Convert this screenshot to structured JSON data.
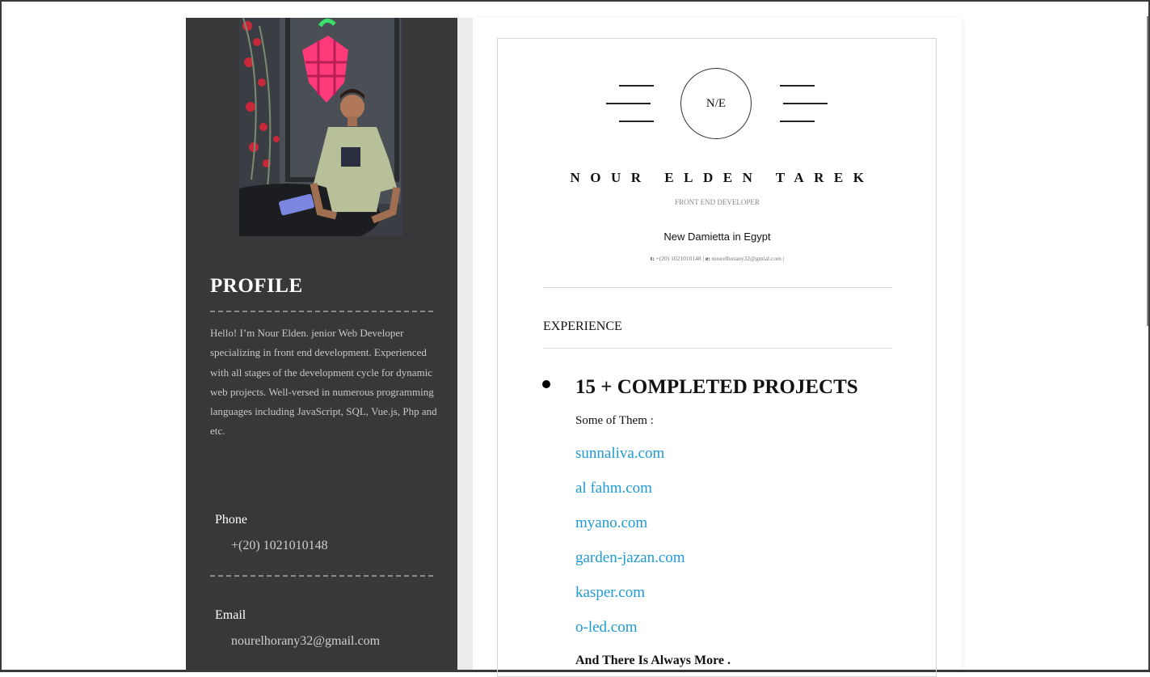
{
  "sidebar": {
    "profile_heading": "PROFILE",
    "bio": "Hello! I’m Nour Elden. jenior Web Developer specializing in front end development. Experienced with all stages of the development cycle for dynamic web projects. Well-versed in numerous programming languages including JavaScript, SQL, Vue.js, Php and etc.",
    "phone_label": "Phone",
    "phone_value": "+(20) 1021010148",
    "email_label": "Email",
    "email_value": "nourelhorany32@gmail.com"
  },
  "header": {
    "monogram": "N/E",
    "name": "NOUR ELDEN TAREK",
    "role": "FRONT END DEVELOPER",
    "location": "New Damietta in Egypt",
    "contact_t_label": "t:",
    "contact_t_value": "+(20) 1021010148 |",
    "contact_e_label": "e:",
    "contact_e_value": "nourelhorany32@gmial.com |"
  },
  "experience": {
    "section_title": "EXPERIENCE",
    "projects_title": "15 + COMPLETED PROJECTS",
    "some_label": "Some of Them :",
    "links": [
      "sunnaliva.com",
      "al fahm.com",
      "myano.com",
      "garden-jazan.com",
      "kasper.com",
      "o-led.com"
    ],
    "more_label": "And There Is Always More ."
  },
  "colors": {
    "sidebar_bg": "#38383a",
    "link": "#1e9bd7"
  }
}
